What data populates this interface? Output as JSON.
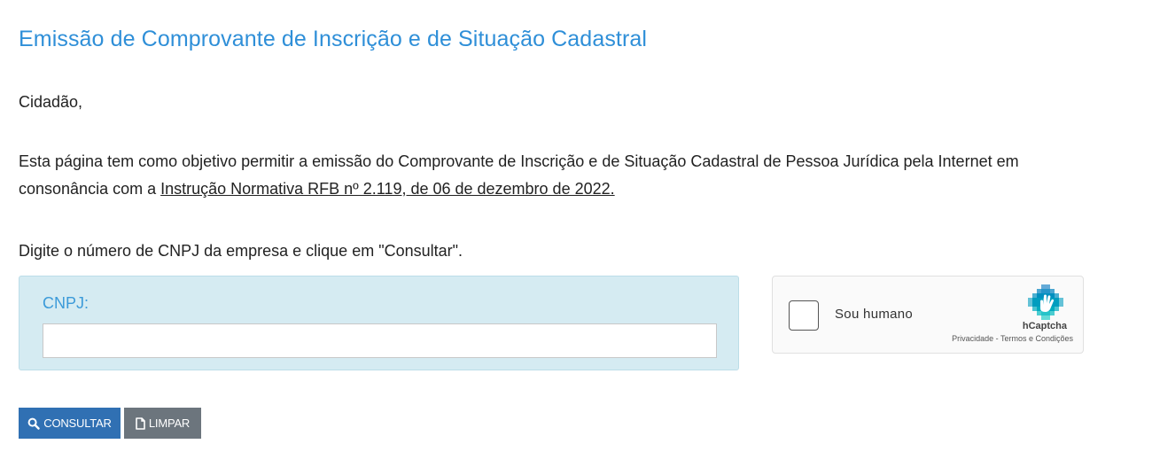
{
  "page": {
    "title": "Emissão de Comprovante de Inscrição e de Situação Cadastral",
    "greeting": "Cidadão,",
    "paragraph_text": "Esta página tem como objetivo permitir a emissão do Comprovante de Inscrição e de Situação Cadastral de Pessoa Jurídica pela Internet em consonância com a ",
    "paragraph_link": "Instrução Normativa RFB nº 2.119, de 06 de dezembro de 2022.",
    "instruction": "Digite o número de CNPJ da empresa e clique em \"Consultar\"."
  },
  "form": {
    "cnpj_label": "CNPJ:",
    "cnpj_value": "",
    "cnpj_placeholder": ""
  },
  "captcha": {
    "label": "Sou humano",
    "brand": "hCaptcha",
    "privacy_link": "Privacidade",
    "separator": " - ",
    "terms_link": "Termos e Condições",
    "checked": false
  },
  "buttons": {
    "consultar_label": "CONSULTAR",
    "consultar_icon": "search-icon",
    "limpar_label": "LIMPAR",
    "limpar_icon": "file-icon"
  },
  "colors": {
    "title": "#2f8fd8",
    "cnpj_box_bg": "#d5ebf2",
    "consultar_bg": "#3070b3",
    "limpar_bg": "#6c757d"
  }
}
